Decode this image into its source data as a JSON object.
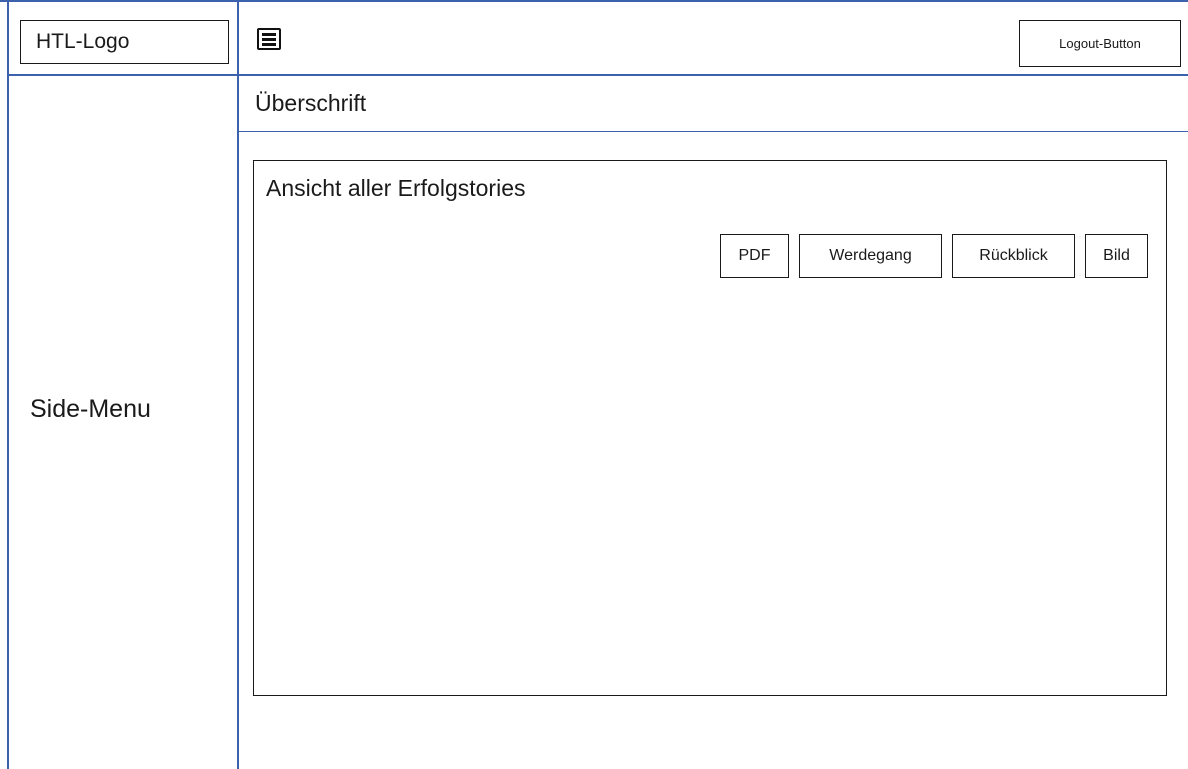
{
  "header": {
    "logo_text": "HTL-Logo",
    "menu_icon": "hamburger-menu-icon",
    "logout_label": "Logout-Button"
  },
  "sidebar": {
    "label": "Side-Menu"
  },
  "main": {
    "title": "Überschrift",
    "panel": {
      "title": "Ansicht aller Erfolgstories",
      "tabs": [
        {
          "label": "PDF"
        },
        {
          "label": "Werdegang"
        },
        {
          "label": "Rückblick"
        },
        {
          "label": "Bild"
        }
      ]
    }
  },
  "colors": {
    "frame_lines": "#3d62ad",
    "borders": "#1a1a1a",
    "background": "#ffffff"
  }
}
